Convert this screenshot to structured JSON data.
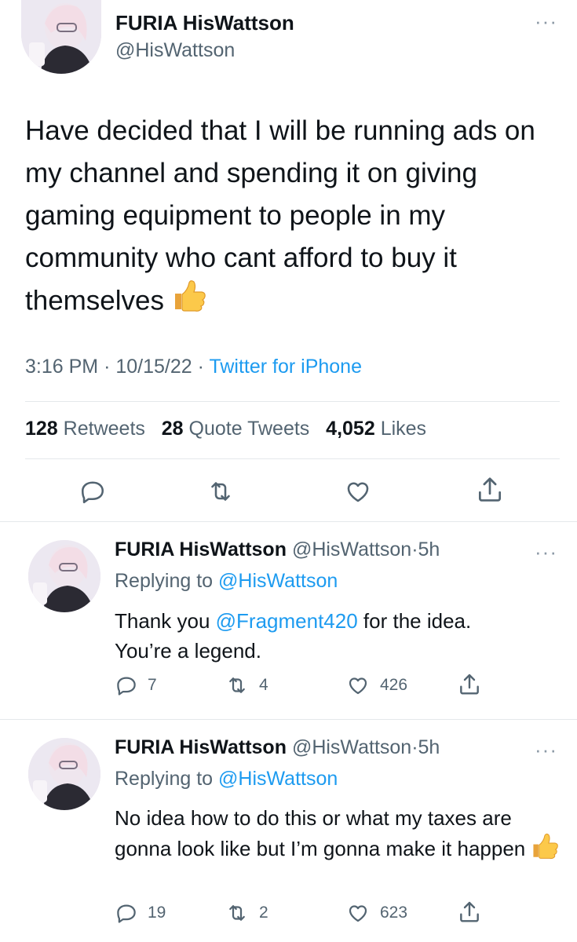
{
  "main_tweet": {
    "display_name": "FURIA HisWattson",
    "handle": "@HisWattson",
    "text": "Have decided that I will be running ads on my channel and spending it on giving gaming equipment to people in my community who cant afford to buy it themselves",
    "emoji": "thumbs-up",
    "time": "3:16 PM",
    "date": "10/15/22",
    "source": "Twitter for iPhone",
    "separator": "·",
    "stats": {
      "retweets_count": "128",
      "retweets_label": "Retweets",
      "quotes_count": "28",
      "quotes_label": "Quote Tweets",
      "likes_count": "4,052",
      "likes_label": "Likes"
    }
  },
  "replies": [
    {
      "display_name": "FURIA HisWattson",
      "handle": "@HisWattson",
      "separator": "·",
      "age": "5h",
      "replying_prefix": "Replying to",
      "replying_to": "@HisWattson",
      "text_before": "Thank you",
      "mention": "@Fragment420",
      "text_after": "for the idea.",
      "text_line2": "You’re a legend.",
      "replies": "7",
      "retweets": "4",
      "likes": "426"
    },
    {
      "display_name": "FURIA HisWattson",
      "handle": "@HisWattson",
      "separator": "·",
      "age": "5h",
      "replying_prefix": "Replying to",
      "replying_to": "@HisWattson",
      "text": "No idea how to do this or what my taxes are gonna look like but I’m gonna make it happen",
      "emoji": "thumbs-up",
      "replies": "19",
      "retweets": "2",
      "likes": "623"
    }
  ],
  "icons": [
    "more-icon",
    "reply-icon",
    "retweet-icon",
    "like-icon",
    "share-icon",
    "thumbs-up-emoji"
  ],
  "colors": {
    "link": "#1d9bf0",
    "secondary_text": "#536471",
    "divider": "#e4e8eb"
  }
}
